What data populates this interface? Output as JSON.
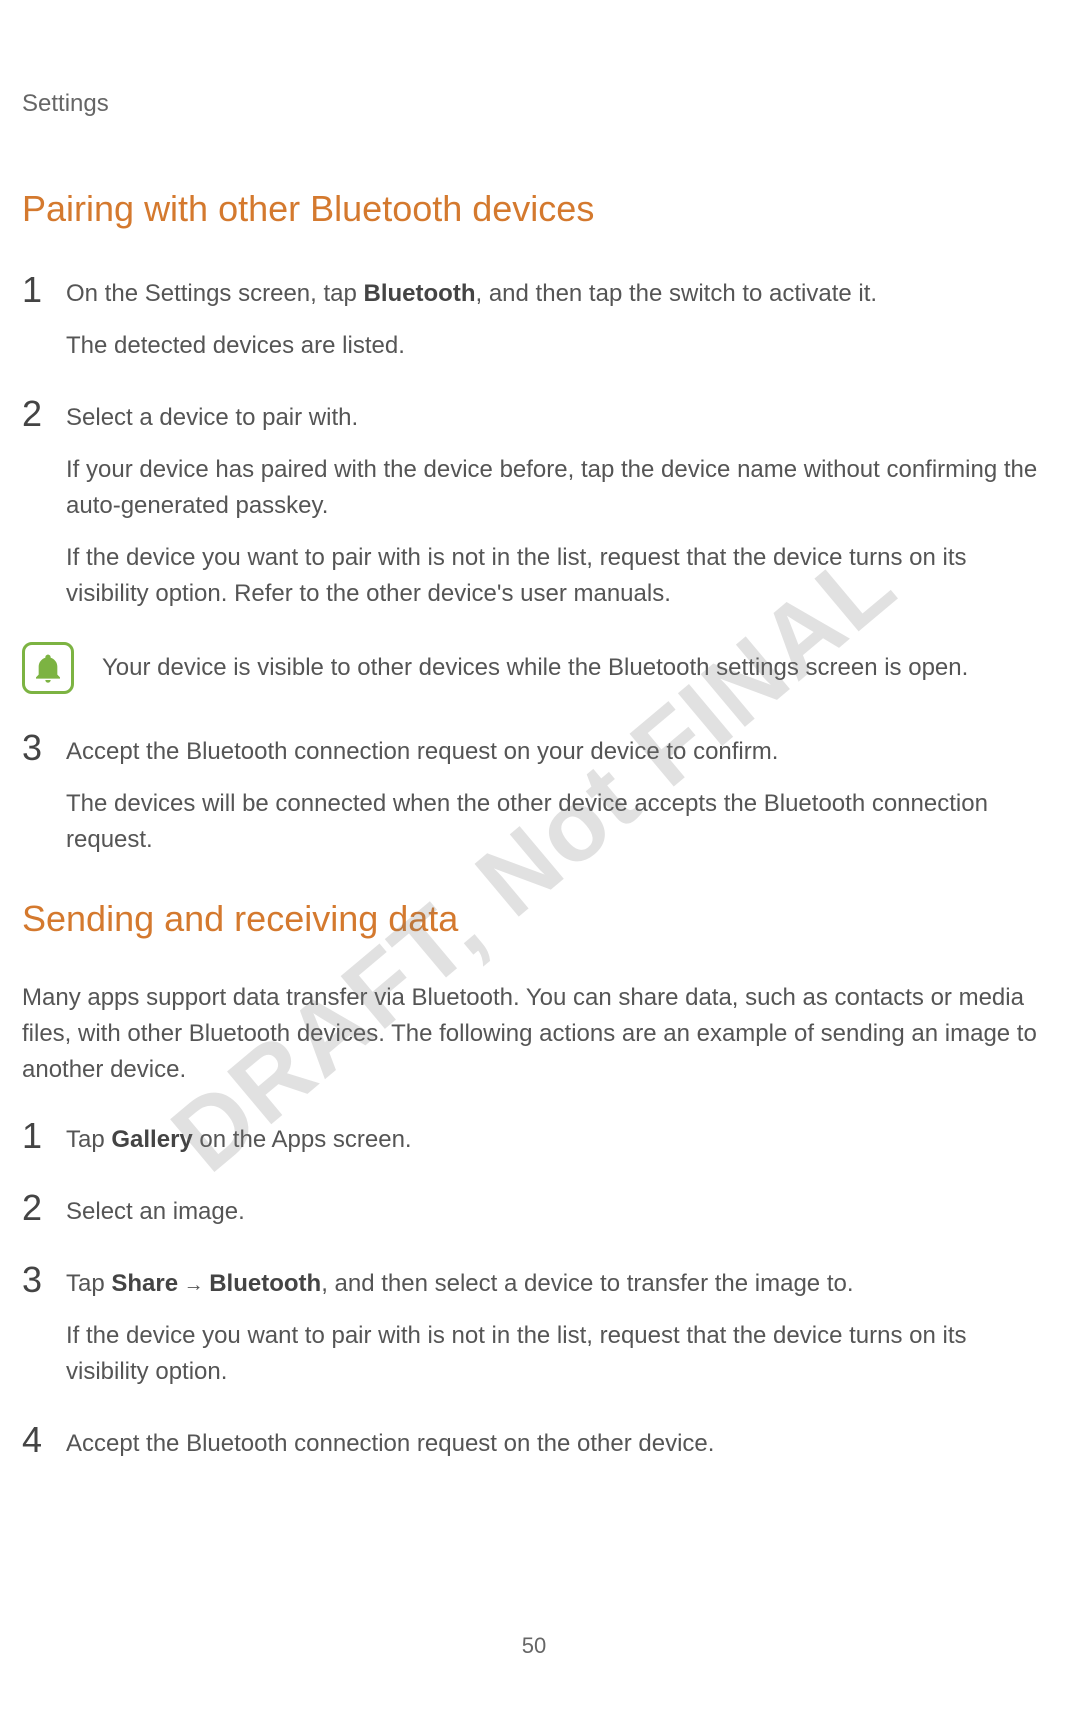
{
  "header": {
    "title": "Settings"
  },
  "watermark": "DRAFT, Not FINAL",
  "pageNumber": "50",
  "sections": [
    {
      "heading": "Pairing with other Bluetooth devices",
      "steps": [
        {
          "number": "1",
          "lines": [
            {
              "prefix": "On the Settings screen, tap ",
              "bold1": "Bluetooth",
              "suffix": ", and then tap the switch to activate it."
            },
            {
              "text": "The detected devices are listed."
            }
          ]
        },
        {
          "number": "2",
          "lines": [
            {
              "text": "Select a device to pair with."
            },
            {
              "text": "If your device has paired with the device before, tap the device name without confirming the auto-generated passkey."
            },
            {
              "text": "If the device you want to pair with is not in the list, request that the device turns on its visibility option. Refer to the other device's user manuals."
            }
          ]
        }
      ],
      "note": "Your device is visible to other devices while the Bluetooth settings screen is open.",
      "stepsAfterNote": [
        {
          "number": "3",
          "lines": [
            {
              "text": "Accept the Bluetooth connection request on your device to confirm."
            },
            {
              "text": "The devices will be connected when the other device accepts the Bluetooth connection request."
            }
          ]
        }
      ]
    },
    {
      "heading": "Sending and receiving data",
      "intro": "Many apps support data transfer via Bluetooth. You can share data, such as contacts or media files, with other Bluetooth devices. The following actions are an example of sending an image to another device.",
      "steps": [
        {
          "number": "1",
          "lines": [
            {
              "prefix": "Tap ",
              "bold1": "Gallery",
              "suffix": " on the Apps screen."
            }
          ]
        },
        {
          "number": "2",
          "lines": [
            {
              "text": "Select an image."
            }
          ]
        },
        {
          "number": "3",
          "lines": [
            {
              "prefix": "Tap ",
              "bold1": "Share",
              "mid": " → ",
              "bold2": "Bluetooth",
              "suffix": ", and then select a device to transfer the image to."
            },
            {
              "text": "If the device you want to pair with is not in the list, request that the device turns on its visibility option."
            }
          ]
        },
        {
          "number": "4",
          "lines": [
            {
              "text": "Accept the Bluetooth connection request on the other device."
            }
          ]
        }
      ]
    }
  ]
}
